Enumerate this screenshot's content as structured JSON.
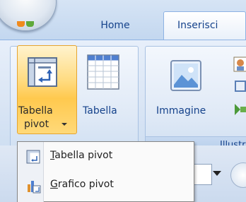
{
  "tabs": {
    "home": "Home",
    "insert": "Inserisci"
  },
  "ribbon": {
    "pivot_button": {
      "line1": "Tabella",
      "line2": "pivot"
    },
    "table_button": "Tabella",
    "image_button": "Immagine",
    "illustrations_group": "Illustrazioni"
  },
  "menu": {
    "items": [
      {
        "accel": "T",
        "rest": "abella pivot"
      },
      {
        "accel": "G",
        "rest": "rafico pivot"
      }
    ]
  },
  "colors": {
    "accent_hover": "#ffc94e",
    "tab_text": "#15428b"
  }
}
